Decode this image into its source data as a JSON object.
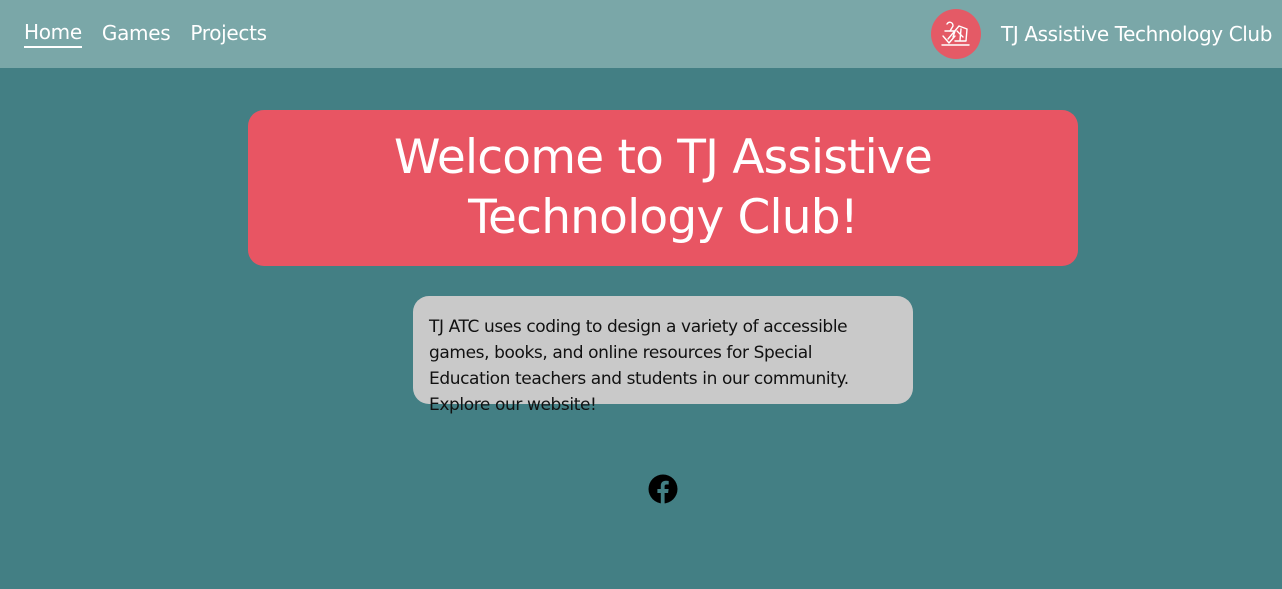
{
  "nav": {
    "links": [
      {
        "label": "Home",
        "active": true
      },
      {
        "label": "Games",
        "active": false
      },
      {
        "label": "Projects",
        "active": false
      }
    ],
    "brand_name": "TJ Assistive Technology Club",
    "logo_icon": "wheelchair-logo-icon"
  },
  "hero": {
    "title": "Welcome to TJ Assistive Technology Club!"
  },
  "info": {
    "text": "TJ ATC uses coding to design a variety of accessible games, books, and online resources for Special Education teachers and students in our community. Explore our website!"
  },
  "social": {
    "icon": "facebook-icon"
  },
  "colors": {
    "page_background": "#437f84",
    "navbar_background": "#7aa7a8",
    "hero_background": "#e85563",
    "info_background": "#c9c9c9",
    "logo_background": "#e45a66"
  }
}
